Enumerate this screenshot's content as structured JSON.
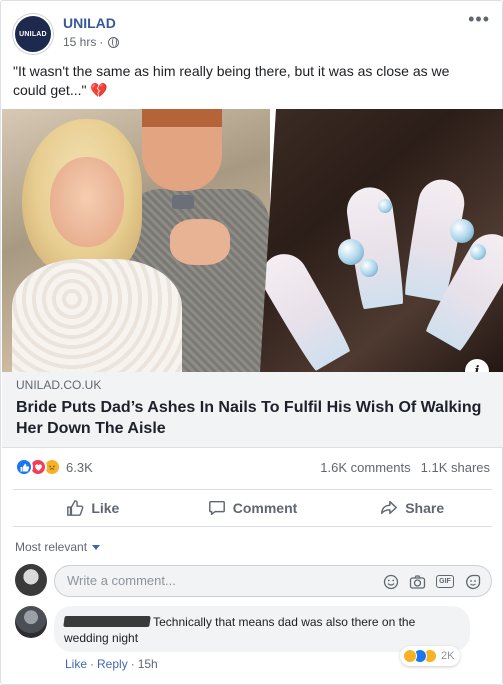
{
  "header": {
    "page_name": "UNILAD",
    "avatar_text": "UNILAD",
    "timestamp": "15 hrs",
    "separator": "·",
    "privacy_icon": "globe-icon",
    "more_icon": "more-horizontal-icon",
    "more_label": "•••"
  },
  "post": {
    "caption": "\"It wasn't the same as him really being there, but it was as close as we could get...\"",
    "caption_emoji": "💔"
  },
  "link": {
    "domain": "UNILAD.CO.UK",
    "title": "Bride Puts Dad’s Ashes In Nails To Fulfil His Wish Of Walking Her Down The Aisle",
    "info_label": "i"
  },
  "stats": {
    "reaction_icons": [
      "like-reaction-icon",
      "love-reaction-icon",
      "sad-reaction-icon"
    ],
    "reaction_count": "6.3K",
    "comments": "1.6K comments",
    "shares": "1.1K shares"
  },
  "actions": {
    "like": "Like",
    "comment": "Comment",
    "share": "Share"
  },
  "comments": {
    "sort_label": "Most relevant",
    "composer_placeholder": "Write a comment...",
    "composer_icons": [
      "emoji-icon",
      "camera-icon",
      "gif-icon",
      "sticker-icon"
    ],
    "gif_label": "GIF",
    "items": [
      {
        "text": "Technically that means dad was also there on the wedding night",
        "reaction_count": "2K",
        "like": "Like",
        "reply": "Reply",
        "time": "15h"
      }
    ]
  },
  "colors": {
    "link_blue": "#385898",
    "text_gray": "#606770",
    "like_blue": "#1877f2",
    "love_red": "#f33e58",
    "sad_yellow": "#f7b125"
  }
}
